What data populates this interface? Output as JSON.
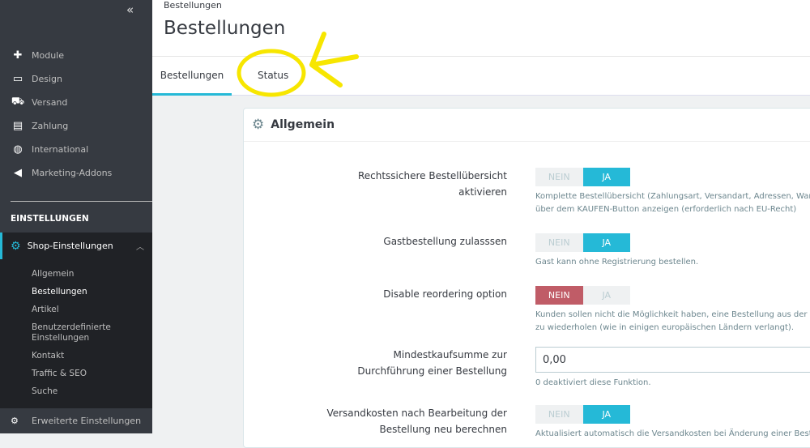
{
  "sidebar": {
    "collapse_icon": "«",
    "items": [
      {
        "label": "Module",
        "icon": "puzzle-icon"
      },
      {
        "label": "Design",
        "icon": "monitor-icon"
      },
      {
        "label": "Versand",
        "icon": "truck-icon"
      },
      {
        "label": "Zahlung",
        "icon": "credit-card-icon"
      },
      {
        "label": "International",
        "icon": "globe-icon"
      },
      {
        "label": "Marketing-Addons",
        "icon": "megaphone-icon"
      }
    ],
    "section_title": "EINSTELLUNGEN",
    "active_group": {
      "label": "Shop-Einstellungen",
      "icon": "gear-icon",
      "subitems": [
        "Allgemein",
        "Bestellungen",
        "Artikel",
        "Benutzerdefinierte Einstellungen",
        "Kontakt",
        "Traffic & SEO",
        "Suche"
      ],
      "current": "Bestellungen"
    },
    "bottom_item": {
      "label": "Erweiterte Einstellungen",
      "icon": "gear-box-icon"
    }
  },
  "header": {
    "breadcrumb": "Bestellungen",
    "title": "Bestellungen",
    "tabs": [
      "Bestellungen",
      "Status"
    ],
    "active_tab": "Bestellungen"
  },
  "panel": {
    "title": "Allgemein",
    "rows": [
      {
        "label": "Rechtssichere Bestellübersicht aktivieren",
        "type": "toggle",
        "value": "JA",
        "help": [
          "Komplette Bestellübersicht (Zahlungsart, Versandart, Adressen, Waren",
          "über dem KAUFEN-Button anzeigen (erforderlich nach EU-Recht)"
        ]
      },
      {
        "label": "Gastbestellung zulasssen",
        "type": "toggle",
        "value": "JA",
        "help": [
          "Gast kann ohne Registrierung bestellen."
        ]
      },
      {
        "label": "Disable reordering option",
        "type": "toggle",
        "value": "NEIN",
        "help": [
          "Kunden sollen nicht die Möglichkeit haben, eine Bestellung aus der",
          "zu wiederholen (wie in einigen europäischen Ländern verlangt)."
        ]
      },
      {
        "label": "Mindestkaufsumme zur Durchführung einer Bestellung",
        "type": "input",
        "value": "0,00",
        "help": [
          "0 deaktiviert diese Funktion."
        ]
      },
      {
        "label": "Versandkosten nach Bearbeitung der Bestellung neu berechnen",
        "type": "toggle",
        "value": "JA",
        "help": [
          "Aktualisiert automatisch die Versandkosten bei Änderung einer Bestellung"
        ]
      }
    ],
    "no_label": "NEIN",
    "yes_label": "JA"
  },
  "annotation_color": "#f7e600"
}
